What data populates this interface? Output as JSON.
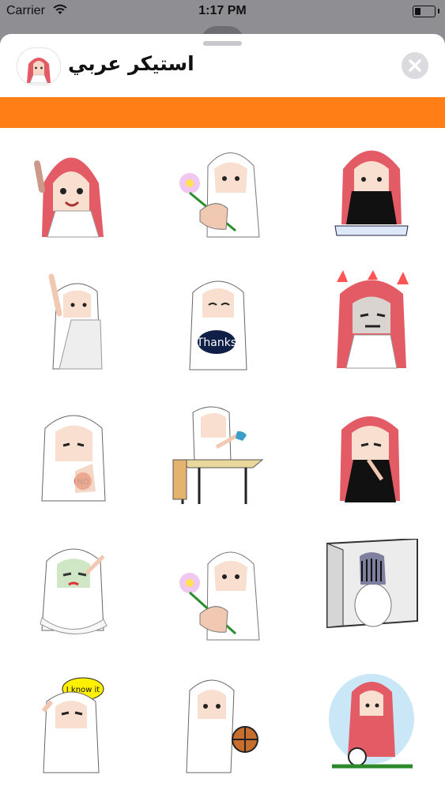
{
  "status_bar": {
    "carrier": "Carrier",
    "time": "1:17 PM",
    "battery_level": 0.3
  },
  "app": {
    "title": "استيكر عربي",
    "close_icon": "close-icon"
  },
  "colors": {
    "accent_bar": "#ff7f16",
    "ghutra_red": "#e35b65",
    "ghutra_white": "#ffffff",
    "black_thobe": "#111111"
  },
  "stickers": [
    {
      "id": "waving-red-ghutra",
      "icon": "sticker-wave"
    },
    {
      "id": "holding-flower",
      "icon": "sticker-flower"
    },
    {
      "id": "reading-book",
      "icon": "sticker-book"
    },
    {
      "id": "raising-hand",
      "icon": "sticker-hand-up"
    },
    {
      "id": "thanks",
      "icon": "sticker-thanks",
      "text": "Thanks"
    },
    {
      "id": "angry",
      "icon": "sticker-angry"
    },
    {
      "id": "no",
      "icon": "sticker-no",
      "text": "NO"
    },
    {
      "id": "drinking-tea",
      "icon": "sticker-tea"
    },
    {
      "id": "black-thobe-thinking",
      "icon": "sticker-thinking"
    },
    {
      "id": "sick-running",
      "icon": "sticker-sick"
    },
    {
      "id": "flower-again",
      "icon": "sticker-flower-2"
    },
    {
      "id": "sad-corner",
      "icon": "sticker-sad"
    },
    {
      "id": "i-know-it",
      "icon": "sticker-i-know-it",
      "text": "I know it"
    },
    {
      "id": "basketball",
      "icon": "sticker-basketball"
    },
    {
      "id": "football",
      "icon": "sticker-football"
    }
  ]
}
